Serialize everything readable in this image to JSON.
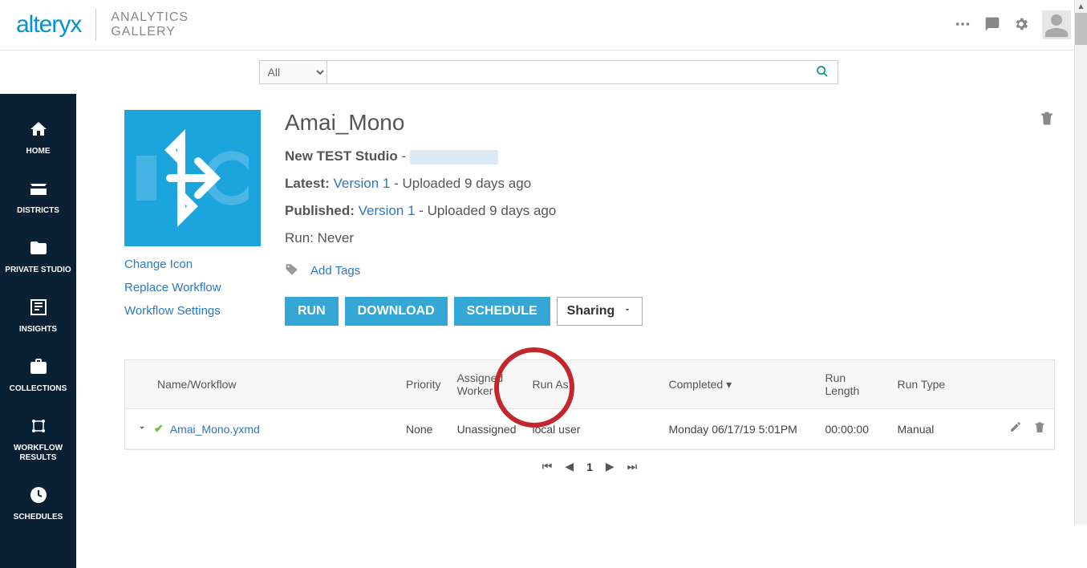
{
  "header": {
    "logo": "alteryx",
    "subtitle_line1": "ANALYTICS",
    "subtitle_line2": "GALLERY"
  },
  "search": {
    "filter": "All",
    "value": ""
  },
  "sidebar": {
    "items": [
      {
        "label": "HOME"
      },
      {
        "label": "DISTRICTS"
      },
      {
        "label": "PRIVATE STUDIO"
      },
      {
        "label": "INSIGHTS"
      },
      {
        "label": "COLLECTIONS"
      },
      {
        "label": "WORKFLOW RESULTS"
      },
      {
        "label": "SCHEDULES"
      }
    ]
  },
  "workflow": {
    "title": "Amai_Mono",
    "studio_label": "New TEST Studio",
    "dash": " - ",
    "latest_label": "Latest:",
    "latest_version": "Version 1",
    "latest_uploaded": " - Uploaded 9 days ago",
    "published_label": "Published:",
    "published_version": "Version 1",
    "published_uploaded": " - Uploaded 9 days ago",
    "run_label": "Run: Never",
    "links": {
      "change_icon": "Change Icon",
      "replace": "Replace Workflow",
      "settings": "Workflow Settings"
    },
    "add_tags": "Add Tags",
    "buttons": {
      "run": "RUN",
      "download": "DOWNLOAD",
      "schedule": "SCHEDULE",
      "sharing": "Sharing"
    }
  },
  "table": {
    "headers": {
      "name": "Name/Workflow",
      "priority": "Priority",
      "worker": "Assigned Worker",
      "runas": "Run As",
      "completed": "Completed",
      "runlength": "Run Length",
      "runtype": "Run Type"
    },
    "row": {
      "name": "Amai_Mono.yxmd",
      "priority": "None",
      "worker": "Unassigned",
      "runas": "local user",
      "completed": "Monday 06/17/19 5:01PM",
      "runlength": "00:00:00",
      "runtype": "Manual"
    },
    "page": "1"
  }
}
